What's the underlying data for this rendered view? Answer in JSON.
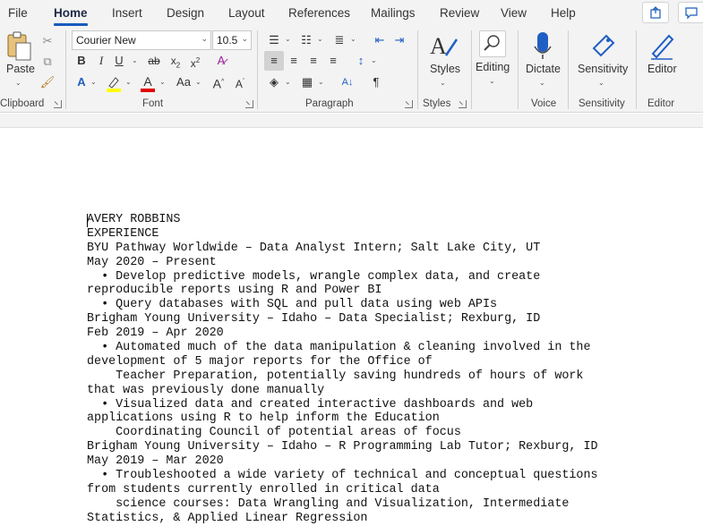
{
  "tabs": [
    "File",
    "Home",
    "Insert",
    "Design",
    "Layout",
    "References",
    "Mailings",
    "Review",
    "View",
    "Help"
  ],
  "active_tab": "Home",
  "ribbon": {
    "clipboard": {
      "label": "Clipboard",
      "paste": "Paste"
    },
    "font": {
      "label": "Font",
      "font_name": "Courier New",
      "font_size": "10.5"
    },
    "paragraph": {
      "label": "Paragraph"
    },
    "styles": {
      "label": "Styles",
      "button": "Styles"
    },
    "editing": {
      "button": "Editing"
    },
    "voice": {
      "label": "Voice",
      "button": "Dictate"
    },
    "sensitivity": {
      "label": "Sensitivity",
      "button": "Sensitivity"
    },
    "editor": {
      "label": "Editor",
      "button": "Editor"
    }
  },
  "colors": {
    "accent": "#185abd",
    "highlight": "#ffff00",
    "font_color": "#e00000"
  },
  "document": {
    "lines": [
      "AVERY ROBBINS",
      "EXPERIENCE",
      "BYU Pathway Worldwide – Data Analyst Intern; Salt Lake City, UT",
      "May 2020 – Present",
      "  • Develop predictive models, wrangle complex data, and create",
      "reproducible reports using R and Power BI",
      "  • Query databases with SQL and pull data using web APIs",
      "Brigham Young University – Idaho – Data Specialist; Rexburg, ID",
      "Feb 2019 – Apr 2020",
      "  • Automated much of the data manipulation & cleaning involved in the",
      "development of 5 major reports for the Office of",
      "    Teacher Preparation, potentially saving hundreds of hours of work",
      "that was previously done manually",
      "  • Visualized data and created interactive dashboards and web",
      "applications using R to help inform the Education",
      "    Coordinating Council of potential areas of focus",
      "Brigham Young University – Idaho – R Programming Lab Tutor; Rexburg, ID",
      "May 2019 – Mar 2020",
      "  • Troubleshooted a wide variety of technical and conceptual questions",
      "from students currently enrolled in critical data",
      "    science courses: Data Wrangling and Visualization, Intermediate",
      "Statistics, & Applied Linear Regression"
    ]
  }
}
